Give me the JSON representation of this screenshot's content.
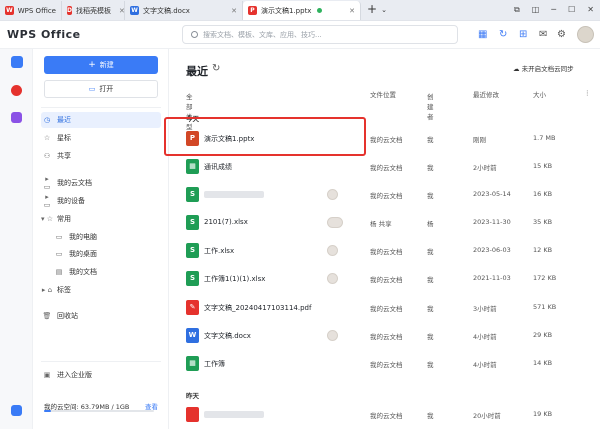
{
  "tabs": [
    {
      "label": "WPS Office",
      "icon": "wps-logo-icon",
      "color": "#e5322d",
      "glyph": "W"
    },
    {
      "label": "找稻壳模板",
      "icon": "docer-icon",
      "color": "#e5322d",
      "glyph": "D"
    },
    {
      "label": "文字文稿.docx",
      "icon": "word-doc-icon",
      "color": "#2f6fe0",
      "glyph": "W"
    },
    {
      "label": "演示文稿1.pptx",
      "icon": "ppt-icon",
      "color": "#e5322d",
      "glyph": "P"
    }
  ],
  "app": {
    "logo": "WPS Office"
  },
  "search": {
    "placeholder": "搜索文档、模板、文库、应用、技巧..."
  },
  "sidebar": {
    "new_label": "新建",
    "open_label": "打开",
    "items": [
      {
        "label": "最近",
        "icon": "clock-icon",
        "glyph": "◷"
      },
      {
        "label": "星标",
        "icon": "star-icon",
        "glyph": "☆"
      },
      {
        "label": "共享",
        "icon": "share-icon",
        "glyph": "⚇"
      },
      {
        "label": "我的云文档",
        "icon": "cloud-folder-icon",
        "glyph": "▸ ▭"
      },
      {
        "label": "我的设备",
        "icon": "device-icon",
        "glyph": "▸ ▭"
      },
      {
        "label": "常用",
        "icon": "pin-icon",
        "glyph": "▾ ☆"
      },
      {
        "label": "我的电脑",
        "icon": "computer-icon",
        "glyph": "▭"
      },
      {
        "label": "我的桌面",
        "icon": "desktop-icon",
        "glyph": "▭"
      },
      {
        "label": "我的文档",
        "icon": "documents-icon",
        "glyph": "▤"
      },
      {
        "label": "标签",
        "icon": "tag-icon",
        "glyph": "▸ ⌂"
      },
      {
        "label": "回收站",
        "icon": "trash-icon",
        "glyph": "🗑"
      }
    ],
    "enterprise_label": "进入企业版",
    "storage_text": "我的云空间: 63.79MB / 1GB",
    "upgrade_label": "查看",
    "storage_fraction": 0.062
  },
  "main": {
    "title": "最近",
    "sync_label": "未开启文档云同步",
    "columns": {
      "type": "全部类型",
      "location": "文件位置",
      "creator": "创建者",
      "modified": "最近修改",
      "size": "大小"
    },
    "group_today": "今天",
    "group_yesterday": "昨天"
  },
  "files": [
    {
      "name": "演示文稿1.pptx",
      "type": "ppt",
      "color": "#d24726",
      "glyph": "P",
      "location": "我的云文档",
      "creator": "我",
      "modified": "刚刚",
      "size": "1.7 MB",
      "blurred": false,
      "shared": ""
    },
    {
      "name": "通讯成绩",
      "type": "sheet",
      "color": "#1f9d55",
      "glyph": "▦",
      "location": "我的云文档",
      "creator": "我",
      "modified": "2小时前",
      "size": "15 KB",
      "blurred": false,
      "shared": ""
    },
    {
      "name": "",
      "type": "sheet",
      "color": "#1f9d55",
      "glyph": "S",
      "location": "我的云文档",
      "creator": "我",
      "modified": "2023-05-14",
      "size": "16 KB",
      "blurred": true,
      "shared": "one"
    },
    {
      "name": "2101(7).xlsx",
      "type": "sheet",
      "color": "#1f9d55",
      "glyph": "S",
      "location": "杨 共享",
      "creator": "杨",
      "modified": "2023-11-30",
      "size": "35 KB",
      "blurred": false,
      "shared": "two"
    },
    {
      "name": "工作.xlsx",
      "type": "sheet",
      "color": "#1f9d55",
      "glyph": "S",
      "location": "我的云文档",
      "creator": "我",
      "modified": "2023-06-03",
      "size": "12 KB",
      "blurred": false,
      "shared": "one"
    },
    {
      "name": "工作簿1(1)(1).xlsx",
      "type": "sheet",
      "color": "#1f9d55",
      "glyph": "S",
      "location": "我的云文档",
      "creator": "我",
      "modified": "2021-11-03",
      "size": "172 KB",
      "blurred": false,
      "shared": "one"
    },
    {
      "name": "文字文稿_20240417103114.pdf",
      "type": "pdf",
      "color": "#e5322d",
      "glyph": "✎",
      "location": "我的云文档",
      "creator": "我",
      "modified": "3小时前",
      "size": "571 KB",
      "blurred": false,
      "shared": ""
    },
    {
      "name": "文字文稿.docx",
      "type": "doc",
      "color": "#2f6fe0",
      "glyph": "W",
      "location": "我的云文档",
      "creator": "我",
      "modified": "4小时前",
      "size": "29 KB",
      "blurred": false,
      "shared": "one"
    },
    {
      "name": "工作簿",
      "type": "sheet",
      "color": "#1f9d55",
      "glyph": "▦",
      "location": "我的云文档",
      "creator": "我",
      "modified": "4小时前",
      "size": "14 KB",
      "blurred": false,
      "shared": ""
    },
    {
      "name": "",
      "type": "other",
      "color": "#e5322d",
      "glyph": "",
      "location": "我的云文档",
      "creator": "我",
      "modified": "20小时前",
      "size": "19 KB",
      "blurred": true,
      "shared": ""
    }
  ],
  "colors": {
    "accent": "#3a7bf6",
    "highlight": "#e5322d"
  }
}
